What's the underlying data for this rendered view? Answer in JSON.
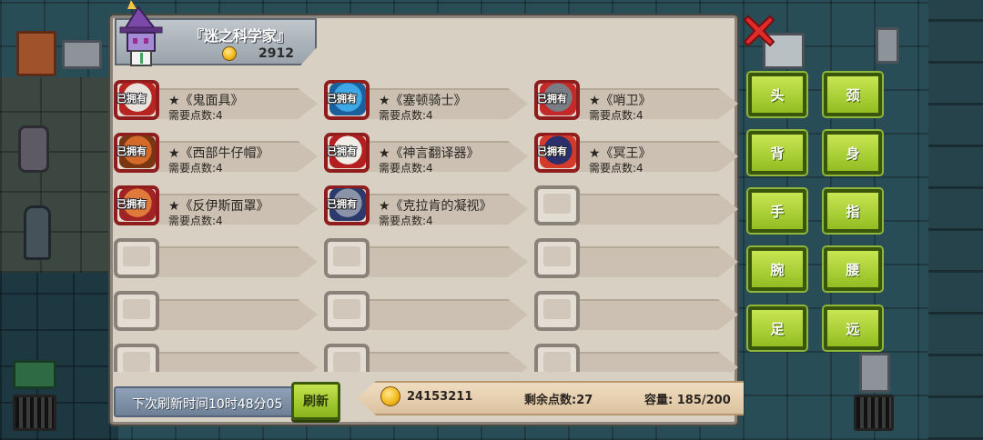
{
  "shop": {
    "title": "『迷之科学家』",
    "player_coins": "2912",
    "items": [
      {
        "owned": true,
        "name": "★《鬼面具》",
        "cost": "需要点数:4",
        "art": "ghost-mask-icon",
        "color": "#e8e2dc",
        "accent": "#b8241f"
      },
      {
        "owned": true,
        "name": "★《塞顿骑士》",
        "cost": "需要点数:4",
        "art": "seton-knight-icon",
        "color": "#3ea7e6",
        "accent": "#1d5f9a"
      },
      {
        "owned": true,
        "name": "★《哨卫》",
        "cost": "需要点数:4",
        "art": "sentinel-icon",
        "color": "#7a7d84",
        "accent": "#c42a2a"
      },
      {
        "owned": true,
        "name": "★《西部牛仔帽》",
        "cost": "需要点数:4",
        "art": "cowboy-hat-icon",
        "color": "#d36a2a",
        "accent": "#7a3512"
      },
      {
        "owned": true,
        "name": "★《神言翻译器》",
        "cost": "需要点数:4",
        "art": "translator-icon",
        "color": "#f0ece6",
        "accent": "#b42020"
      },
      {
        "owned": true,
        "name": "★《冥王》",
        "cost": "需要点数:4",
        "art": "hades-icon",
        "color": "#2b2f6b",
        "accent": "#d23b2b"
      },
      {
        "owned": true,
        "name": "★《反伊斯面罩》",
        "cost": "需要点数:4",
        "art": "anti-ice-mask-icon",
        "color": "#e07a3a",
        "accent": "#a02424"
      },
      {
        "owned": true,
        "name": "★《克拉肯的凝视》",
        "cost": "需要点数:4",
        "art": "kraken-gaze-icon",
        "color": "#8a93a8",
        "accent": "#2b3a6b"
      },
      {
        "owned": false,
        "name": "",
        "cost": ""
      },
      {
        "owned": false,
        "name": "",
        "cost": ""
      },
      {
        "owned": false,
        "name": "",
        "cost": ""
      },
      {
        "owned": false,
        "name": "",
        "cost": ""
      },
      {
        "owned": false,
        "name": "",
        "cost": ""
      },
      {
        "owned": false,
        "name": "",
        "cost": ""
      },
      {
        "owned": false,
        "name": "",
        "cost": ""
      },
      {
        "owned": false,
        "name": "",
        "cost": ""
      },
      {
        "owned": false,
        "name": "",
        "cost": ""
      },
      {
        "owned": false,
        "name": "",
        "cost": ""
      }
    ],
    "owned_label": "已拥有"
  },
  "footer": {
    "refresh_timer": "下次刷新时间10时48分05",
    "refresh_button": "刷新",
    "total_coins": "24153211",
    "remaining_points": "剩余点数:27",
    "capacity": "容量:  185/200"
  },
  "categories": [
    "头",
    "颈",
    "背",
    "身",
    "手",
    "指",
    "腕",
    "腰",
    "足",
    "远"
  ],
  "colors": {
    "panel": "#d9d0c4",
    "category_button": "#a8cf2e",
    "close": "#e02b2b"
  }
}
